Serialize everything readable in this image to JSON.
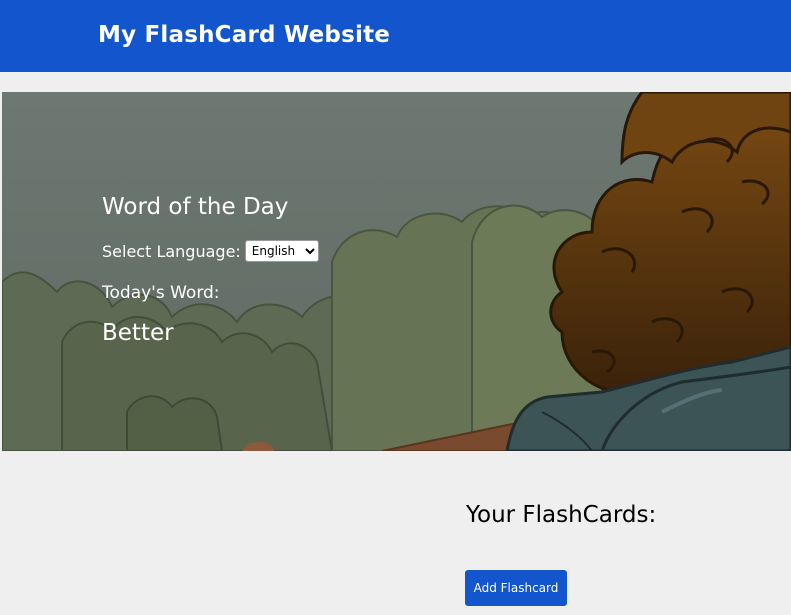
{
  "header": {
    "title": "My FlashCard Website",
    "color": "#1255cc"
  },
  "hero": {
    "title": "Word of the Day",
    "language_label": "Select Language:",
    "language_selected": "English",
    "today_label": "Today's Word:",
    "today_word": "Better",
    "image": "cartoon-character-in-park"
  },
  "flashcards": {
    "heading": "Your FlashCards:",
    "add_button_label": "Add Flashcard"
  }
}
